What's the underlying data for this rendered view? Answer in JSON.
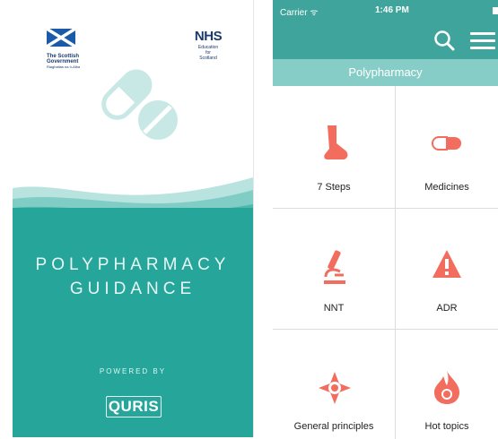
{
  "splash": {
    "gov_logo_line1": "The Scottish",
    "gov_logo_line2": "Government",
    "gov_logo_line3": "Riaghaltas na h-Alba",
    "nhs_mark": "NHS",
    "nhs_line1": "Education",
    "nhs_line2": "for",
    "nhs_line3": "Scotland",
    "title_line1": "POLYPHARMACY",
    "title_line2": "GUIDANCE",
    "powered_by": "POWERED BY",
    "brand": "QURIS"
  },
  "status_bar": {
    "carrier": "Carrier ᯤ",
    "time": "1:46 PM"
  },
  "navbar": {
    "section_title": "Polypharmacy"
  },
  "tiles": [
    {
      "label": "7 Steps",
      "icon": "foot-icon"
    },
    {
      "label": "Medicines",
      "icon": "capsule-icon"
    },
    {
      "label": "NNT",
      "icon": "microscope-icon"
    },
    {
      "label": "ADR",
      "icon": "warning-icon"
    },
    {
      "label": "General principles",
      "icon": "compass-icon"
    },
    {
      "label": "Hot topics",
      "icon": "flame-icon"
    }
  ],
  "colors": {
    "teal": "#26a69a",
    "nav_teal": "#3fa49b",
    "section_bar": "#86cdc7",
    "icon_coral": "#f26d5e"
  }
}
